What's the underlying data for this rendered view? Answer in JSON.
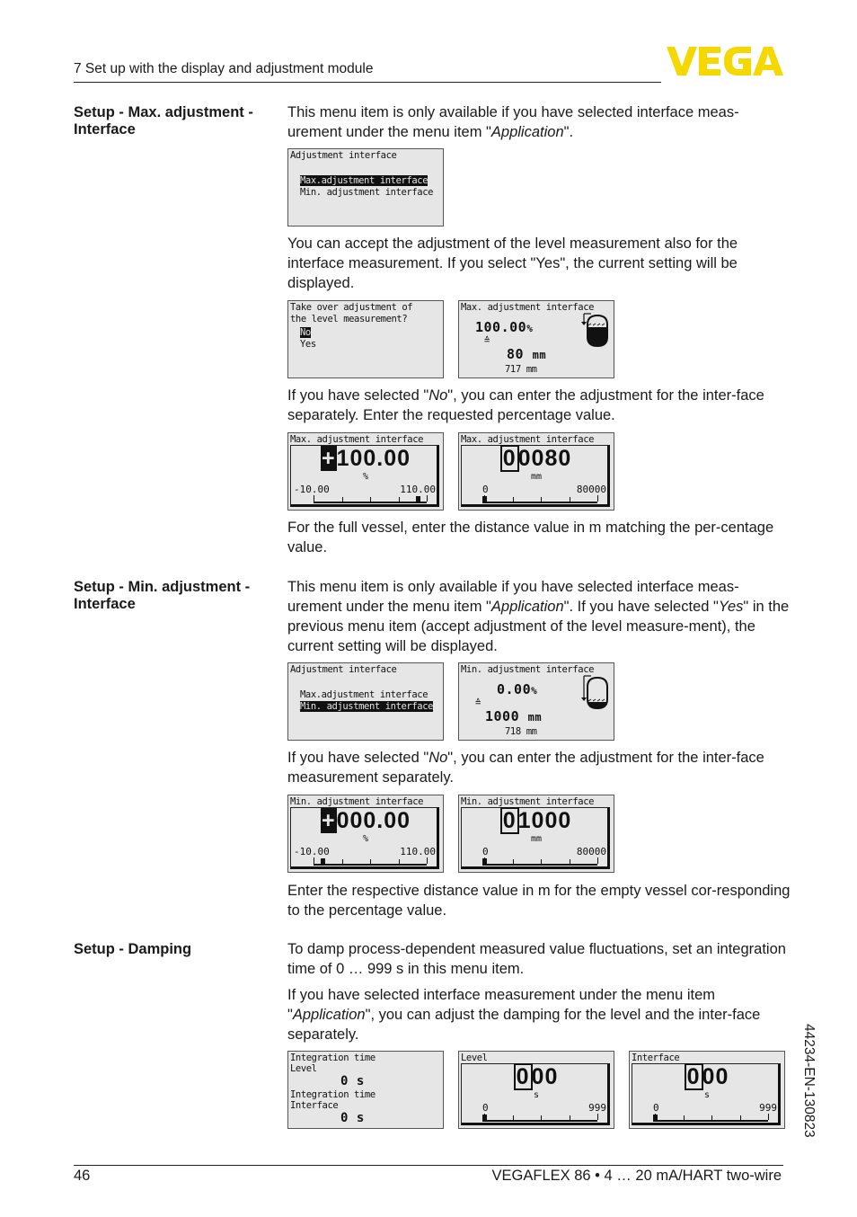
{
  "header": {
    "chapter": "7 Set up with the display and adjustment module",
    "logo_text": "VEGA",
    "logo_color": "#f5d800"
  },
  "sections": {
    "max": {
      "label": "Setup - Max. adjustment - Interface",
      "p1_a": "This menu item is only available if you have selected interface meas-urement under the menu item \"",
      "p1_app": "Application",
      "p1_b": "\".",
      "p2": "You can accept the adjustment of the level measurement also for the interface measurement. If you select \"Yes\", the current setting will be displayed.",
      "p3_a": "If you have selected \"",
      "p3_no": "No",
      "p3_b": "\", you can enter the adjustment for the inter-face separately. Enter the requested percentage value.",
      "p4": "For the full vessel, enter the distance value in m matching the per-centage value."
    },
    "min": {
      "label": "Setup - Min. adjustment - Interface",
      "p1_a": "This menu item is only available if you have selected interface meas-urement under the menu item \"",
      "p1_app": "Application",
      "p1_b": "\". If you have selected \"",
      "p1_yes": "Yes",
      "p1_c": "\" in the previous menu item (accept adjustment of the level measure-ment), the current setting will be displayed.",
      "p2_a": "If you have selected \"",
      "p2_no": "No",
      "p2_b": "\", you can enter the adjustment for the inter-face measurement separately.",
      "p3": "Enter the respective distance value in m for the empty vessel cor-responding to the percentage value."
    },
    "damping": {
      "label": "Setup - Damping",
      "p1": "To damp process-dependent measured value fluctuations, set an integration time of 0 … 999 s in this menu item.",
      "p2_a": "If you have selected interface measurement under the menu item \"",
      "p2_app": "Application",
      "p2_b": "\", you can adjust the damping for the level and the inter-face separately."
    }
  },
  "screens": {
    "adj_menu_max": {
      "title": "Adjustment interface",
      "items": [
        "Max.adjustment interface",
        "Min. adjustment interface"
      ],
      "selected": 0
    },
    "take_over": {
      "line1": "Take over adjustment of",
      "line2": "the level measurement?",
      "options": [
        "No",
        "Yes"
      ],
      "selected": 0
    },
    "max_view": {
      "title": "Max. adjustment interface",
      "percent": "100.00",
      "percent_unit": "%",
      "equiv": "≙",
      "distance": "80",
      "distance_unit": "mm",
      "measured": "717",
      "measured_unit": "mm"
    },
    "max_edit_pct": {
      "title": "Max. adjustment interface",
      "cursor": "+",
      "value": "100.00",
      "unit": "%",
      "min": "-10.00",
      "max": "110.00",
      "position": 0.917
    },
    "max_edit_dist": {
      "title": "Max. adjustment interface",
      "cursor": "0",
      "value": "0080",
      "unit": "mm",
      "min": "0",
      "max": "80000",
      "position": 0.0
    },
    "adj_menu_min": {
      "title": "Adjustment interface",
      "items": [
        "Max.adjustment interface",
        "Min. adjustment interface"
      ],
      "selected": 1
    },
    "min_view": {
      "title": "Min. adjustment interface",
      "percent": "0.00",
      "percent_unit": "%",
      "equiv": "≙",
      "distance": "1000",
      "distance_unit": "mm",
      "measured": "718",
      "measured_unit": "mm"
    },
    "min_edit_pct": {
      "title": "Min. adjustment interface",
      "cursor": "+",
      "value": "000.00",
      "unit": "%",
      "min": "-10.00",
      "max": "110.00",
      "position": 0.083
    },
    "min_edit_dist": {
      "title": "Min. adjustment interface",
      "cursor": "0",
      "value": "1000",
      "unit": "mm",
      "min": "0",
      "max": "80000",
      "position": 0.0
    },
    "damp_overview": {
      "l1": "Integration time",
      "l2": "Level",
      "v1": "0 s",
      "l3": "Integration time",
      "l4": "Interface",
      "v2": "0 s"
    },
    "damp_level": {
      "title": "Level",
      "cursor": "0",
      "value": "00",
      "unit": "s",
      "min": "0",
      "max": "999",
      "position": 0.0
    },
    "damp_interface": {
      "title": "Interface",
      "cursor": "0",
      "value": "00",
      "unit": "s",
      "min": "0",
      "max": "999",
      "position": 0.0
    }
  },
  "side_code": "44234-EN-130823",
  "footer": {
    "page": "46",
    "product": "VEGAFLEX 86 • 4 … 20 mA/HART two-wire"
  }
}
